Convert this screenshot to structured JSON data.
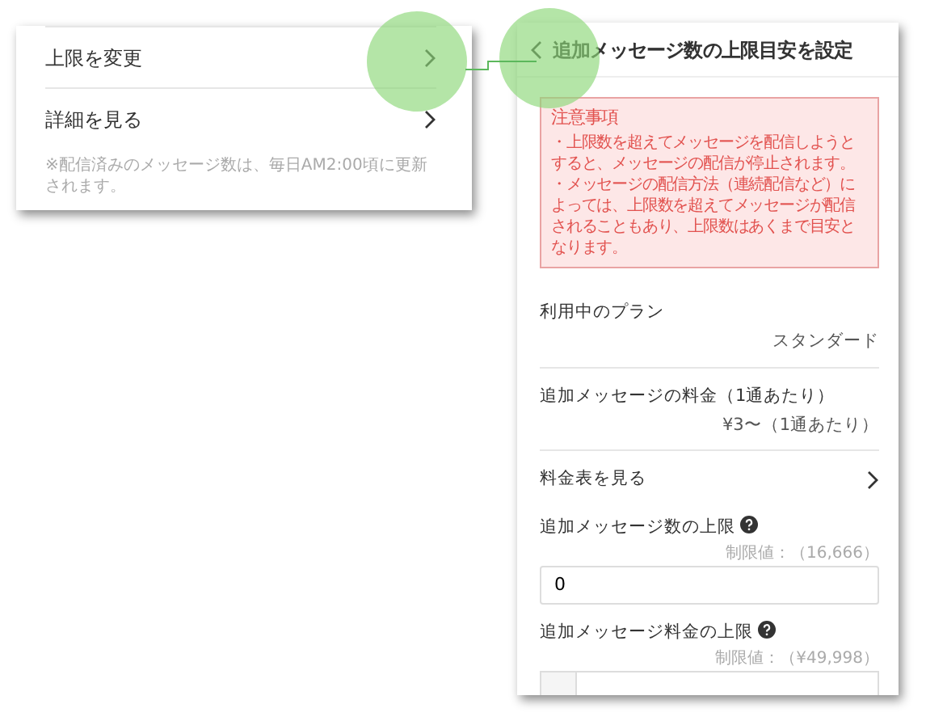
{
  "left_panel": {
    "rows": [
      {
        "label": "上限を変更",
        "highlighted": true
      },
      {
        "label": "詳細を見る",
        "highlighted": false
      }
    ],
    "note": "※配信済みのメッセージ数は、毎日AM2:00頃に更新されます。"
  },
  "right_panel": {
    "title": "追加メッセージ数の上限目安を設定",
    "back_highlighted": true,
    "notice": {
      "title": "注意事項",
      "lines": [
        "・上限数を超えてメッセージを配信しようとすると、メッセージの配信が停止されます。",
        "・メッセージの配信方法（連続配信など）によっては、上限数を超えてメッセージが配信されることもあり、上限数はあくまで目安となります。"
      ]
    },
    "rows": [
      {
        "kind": "info",
        "label": "利用中のプラン",
        "value": "スタンダード"
      },
      {
        "kind": "info",
        "label": "追加メッセージの料金（1通あたり）",
        "value": "¥3〜（1通あたり）"
      },
      {
        "kind": "link",
        "label": "料金表を見る"
      }
    ],
    "fields": [
      {
        "kind": "count",
        "label": "追加メッセージ数の上限",
        "limit": "制限値：（16,666）",
        "value": "0"
      },
      {
        "kind": "price",
        "label": "追加メッセージ料金の上限",
        "limit": "制限値：（¥49,998）"
      }
    ]
  }
}
